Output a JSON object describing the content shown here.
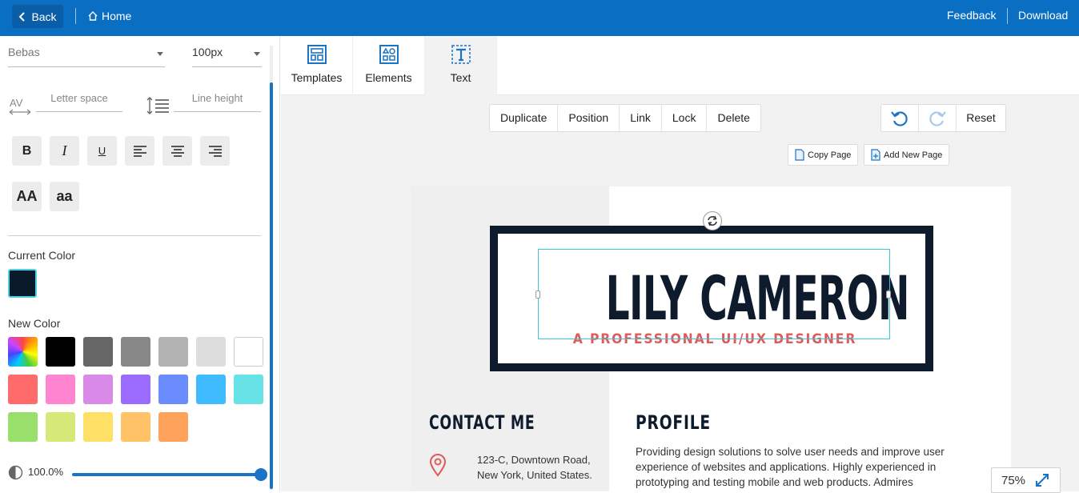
{
  "topbar": {
    "back_label": "Back",
    "home_label": "Home",
    "feedback_label": "Feedback",
    "download_label": "Download"
  },
  "text_panel": {
    "font_family": "Bebas",
    "font_size": "100px",
    "letter_space_placeholder": "Letter space",
    "line_height_placeholder": "Line height",
    "format_buttons": [
      {
        "name": "bold",
        "glyph": "B"
      },
      {
        "name": "italic",
        "glyph": "I"
      },
      {
        "name": "underline",
        "glyph": "U"
      }
    ],
    "case_buttons": {
      "upper": "AA",
      "lower": "aa"
    },
    "current_color_label": "Current Color",
    "current_color": "#0b1a2b",
    "new_color_label": "New Color",
    "palette": [
      "rainbow",
      "#000000",
      "#666666",
      "#888888",
      "#b3b3b3",
      "#dddddd",
      "#ffffff",
      "#ff6b6b",
      "#ff85d1",
      "#d98ae8",
      "#9b6bff",
      "#6b8cff",
      "#3fbcff",
      "#67e3e8",
      "#98e06b",
      "#d6e878",
      "#ffe066",
      "#ffc266",
      "#ffa35c"
    ],
    "opacity_value": "100.0%",
    "opacity": 1.0
  },
  "tabs": [
    {
      "label": "Templates",
      "icon": "templates-icon"
    },
    {
      "label": "Elements",
      "icon": "elements-icon"
    },
    {
      "label": "Text",
      "icon": "text-icon",
      "active": true
    }
  ],
  "actions": [
    "Duplicate",
    "Position",
    "Link",
    "Lock",
    "Delete"
  ],
  "history": {
    "reset_label": "Reset"
  },
  "page_actions": {
    "copy_label": "Copy Page",
    "add_label": "Add New Page"
  },
  "document": {
    "name": "LILY CAMERON",
    "subtitle": "A PROFESSIONAL UI/UX DESIGNER",
    "contact_heading": "CONTACT ME",
    "address_line1": "123-C, Downtown Road,",
    "address_line2": "New York, United States.",
    "profile_heading": "PROFILE",
    "profile_text": "Providing design solutions to solve user needs and improve user experience of websites and applications. Highly experienced in prototyping and testing mobile and web products. Admires"
  },
  "zoom": {
    "value": "75%"
  },
  "colors": {
    "brand": "#0a6fc2",
    "accent": "#1a73c4",
    "name_text": "#0e1b2c",
    "subtitle": "#e05a5a"
  }
}
